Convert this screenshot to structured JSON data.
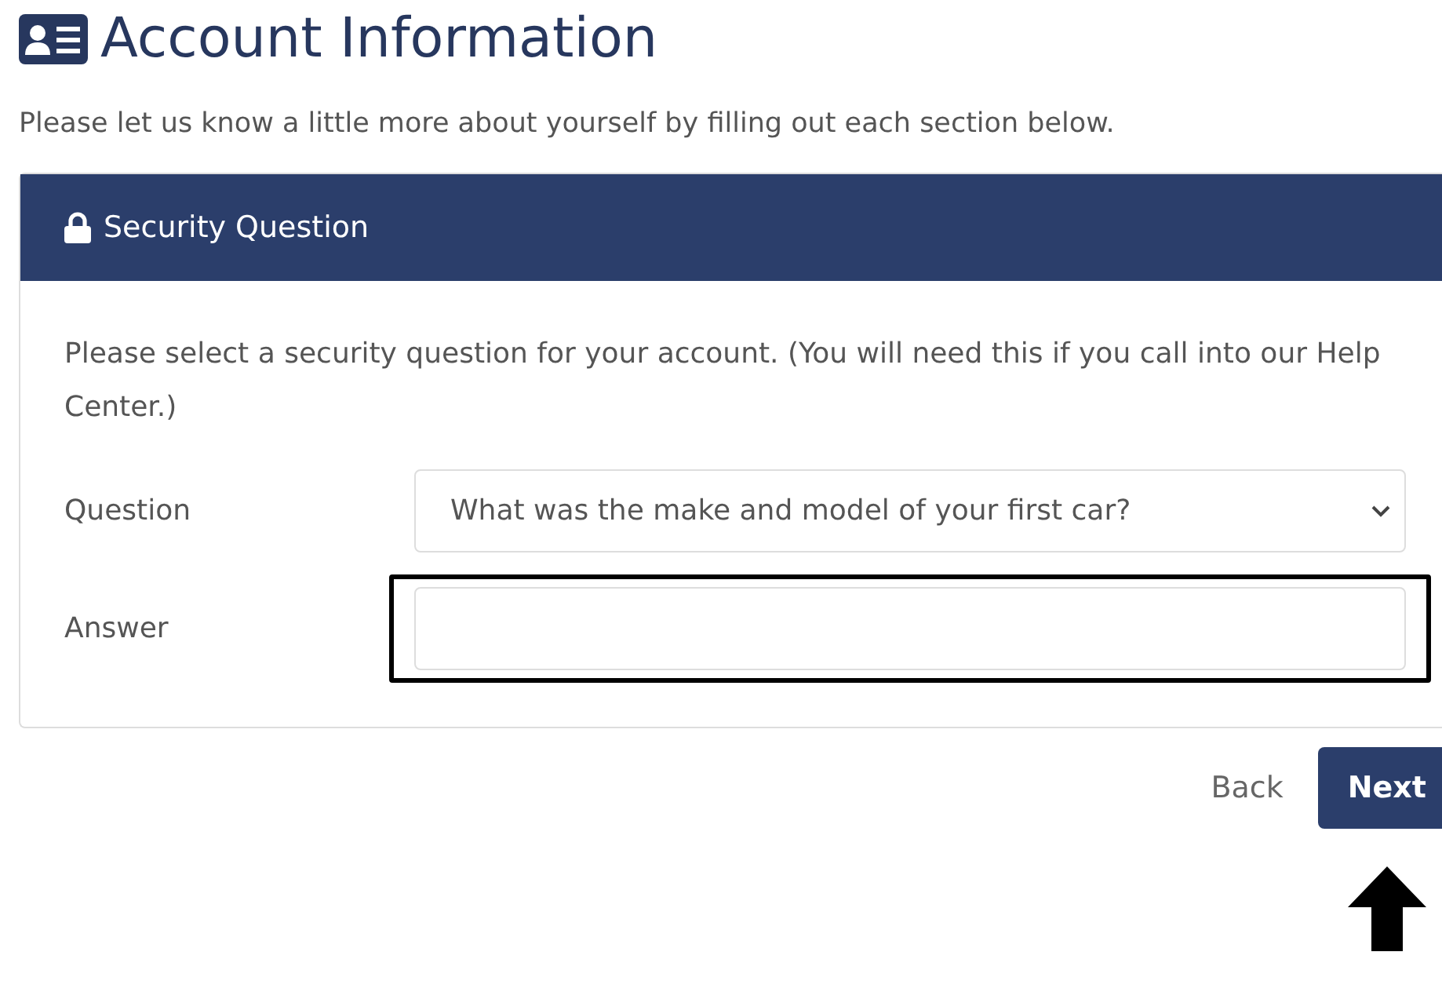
{
  "page": {
    "title": "Account Information",
    "intro": "Please let us know a little more about yourself by filling out each section below."
  },
  "card": {
    "title": "Security Question",
    "instructions": "Please select a security question for your account. (You will need this if you call into our Help Center.)"
  },
  "fields": [
    {
      "label": "Question",
      "kind": "select",
      "value": "What was the make and model of your first car?",
      "highlighted": false
    },
    {
      "label": "Answer",
      "kind": "text",
      "highlighted": true
    }
  ],
  "buttons": [
    {
      "label": "Back",
      "kind": "link"
    },
    {
      "label": "Next",
      "kind": "primary"
    }
  ]
}
